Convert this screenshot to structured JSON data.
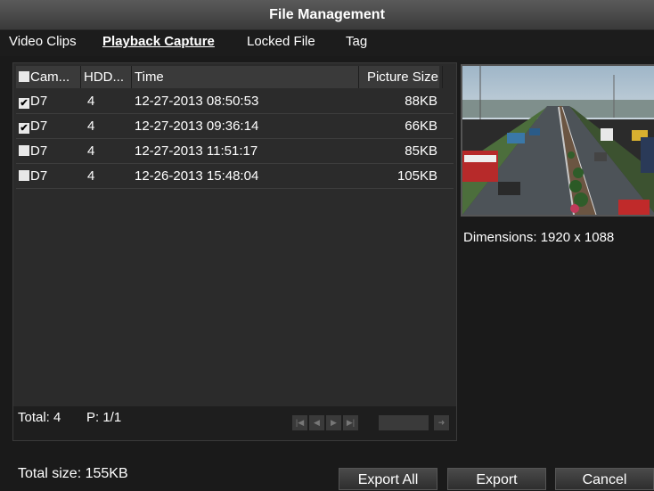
{
  "title": "File Management",
  "tabs": [
    {
      "label": "Video Clips"
    },
    {
      "label": "Playback Capture"
    },
    {
      "label": "Locked File"
    },
    {
      "label": "Tag"
    }
  ],
  "table": {
    "headers": [
      "Cam...",
      "HDD...",
      "Time",
      "Picture Size"
    ],
    "rows": [
      {
        "checked": true,
        "camera": "D7",
        "hdd": "4",
        "time": "12-27-2013 08:50:53",
        "size": "88KB"
      },
      {
        "checked": true,
        "camera": "D7",
        "hdd": "4",
        "time": "12-27-2013 09:36:14",
        "size": "66KB"
      },
      {
        "checked": false,
        "camera": "D7",
        "hdd": "4",
        "time": "12-27-2013 11:51:17",
        "size": "85KB"
      },
      {
        "checked": false,
        "camera": "D7",
        "hdd": "4",
        "time": "12-26-2013 15:48:04",
        "size": "105KB"
      }
    ]
  },
  "footer": {
    "total": "Total: 4",
    "page": "P: 1/1"
  },
  "preview": {
    "dimensions": "Dimensions: 1920 x 1088"
  },
  "bottom": {
    "total_size": "Total size: 155KB",
    "export_all": "Export All",
    "export": "Export",
    "cancel": "Cancel"
  },
  "icons": {
    "first": "skip-first-icon",
    "prev": "prev-icon",
    "next": "next-icon",
    "last": "skip-last-icon",
    "go": "go-arrow-icon"
  },
  "checkmark": "✔"
}
